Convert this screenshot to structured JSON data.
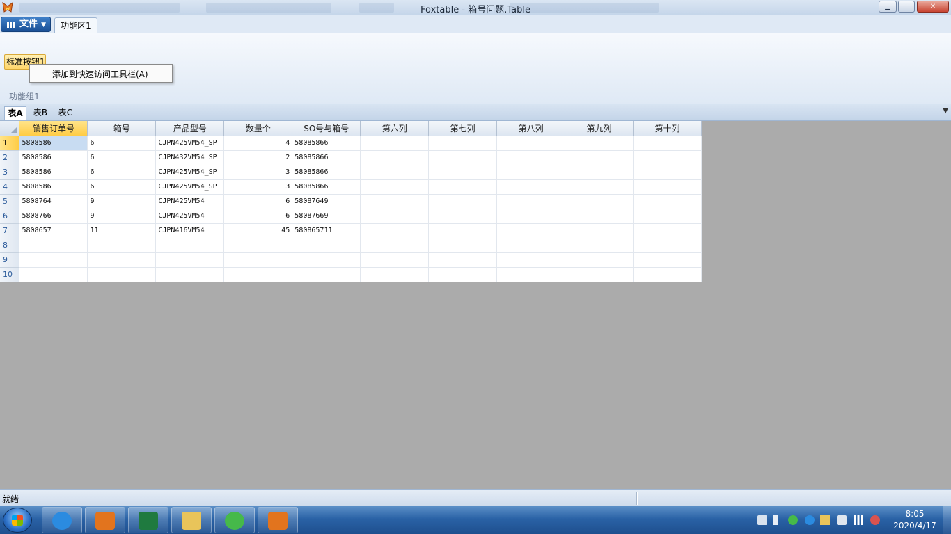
{
  "window": {
    "title": "Foxtable - 箱号问题.Table",
    "min_glyph": "▁",
    "max_glyph": "❐",
    "close_glyph": "✕"
  },
  "ribbon": {
    "file_menu_label": "文件",
    "tabs": [
      "功能区1"
    ],
    "button_label": "标准按钮1",
    "group_label": "功能组1",
    "context_menu_item": "添加到快速访问工具栏(A)"
  },
  "sheet_tabs": [
    {
      "label": "表A",
      "active": true
    },
    {
      "label": "表B",
      "active": false
    },
    {
      "label": "表C",
      "active": false
    }
  ],
  "table": {
    "columns": [
      "销售订单号",
      "箱号",
      "产品型号",
      "数量个",
      "SO号与箱号",
      "第六列",
      "第七列",
      "第八列",
      "第九列",
      "第十列"
    ],
    "rows": [
      [
        "5808586",
        "6",
        "CJPN425VM54_SP",
        "4",
        "58085866",
        "",
        "",
        "",
        "",
        ""
      ],
      [
        "5808586",
        "6",
        "CJPN432VM54_SP",
        "2",
        "58085866",
        "",
        "",
        "",
        "",
        ""
      ],
      [
        "5808586",
        "6",
        "CJPN425VM54_SP",
        "3",
        "58085866",
        "",
        "",
        "",
        "",
        ""
      ],
      [
        "5808586",
        "6",
        "CJPN425VM54_SP",
        "3",
        "58085866",
        "",
        "",
        "",
        "",
        ""
      ],
      [
        "5808764",
        "9",
        "CJPN425VM54",
        "6",
        "58087649",
        "",
        "",
        "",
        "",
        ""
      ],
      [
        "5808766",
        "9",
        "CJPN425VM54",
        "6",
        "58087669",
        "",
        "",
        "",
        "",
        ""
      ],
      [
        "5808657",
        "11",
        "CJPN416VM54",
        "45",
        "580865711",
        "",
        "",
        "",
        "",
        ""
      ],
      [
        "",
        "",
        "",
        "",
        "",
        "",
        "",
        "",
        "",
        ""
      ],
      [
        "",
        "",
        "",
        "",
        "",
        "",
        "",
        "",
        "",
        ""
      ],
      [
        "",
        "",
        "",
        "",
        "",
        "",
        "",
        "",
        "",
        ""
      ]
    ],
    "row_numbers": [
      "1",
      "2",
      "3",
      "4",
      "5",
      "6",
      "7",
      "8",
      "9",
      "10"
    ],
    "numeric_column": 3,
    "selected": {
      "row": 0,
      "col": 0
    }
  },
  "statusbar": {
    "text": "就绪"
  },
  "taskbar": {
    "apps": [
      {
        "name": "ie-icon",
        "color": "#2b8be0"
      },
      {
        "name": "foxtable-icon",
        "color": "#e2741e"
      },
      {
        "name": "excel-icon",
        "color": "#1f7a3f"
      },
      {
        "name": "explorer-folder-icon",
        "color": "#e9c45a"
      },
      {
        "name": "wechat-icon",
        "color": "#46b94a"
      },
      {
        "name": "foxtable-icon",
        "color": "#e2741e"
      }
    ],
    "clock_time": "8:05",
    "clock_date": "2020/4/17"
  }
}
